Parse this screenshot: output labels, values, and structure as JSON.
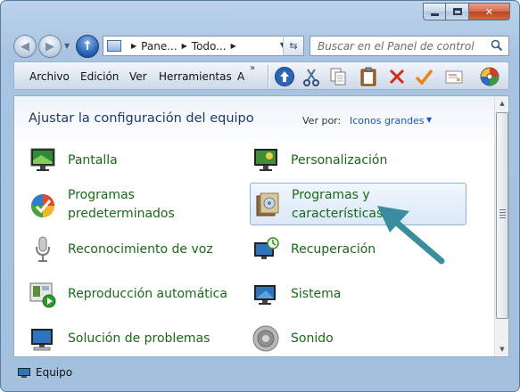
{
  "address": {
    "crumbs": [
      "Pane...",
      "Todo..."
    ]
  },
  "search": {
    "placeholder": "Buscar en el Panel de control"
  },
  "menu": {
    "items": [
      "Archivo",
      "Edición",
      "Ver",
      "Herramientas",
      "A"
    ],
    "overflow": "»"
  },
  "toolbar": {
    "icons": [
      "up-arrow-icon",
      "cut-icon",
      "copy-icon",
      "paste-icon",
      "delete-icon",
      "check-icon",
      "properties-icon",
      "color-wheel-icon"
    ]
  },
  "header": {
    "title": "Ajustar la configuración del equipo",
    "view_label": "Ver por:",
    "view_value": "Iconos grandes"
  },
  "items": [
    {
      "label": "Pantalla",
      "icon": "monitor-icon"
    },
    {
      "label": "Personalización",
      "icon": "personalization-icon"
    },
    {
      "label": "Programas\npredeterminados",
      "icon": "default-programs-icon"
    },
    {
      "label": "Programas y\ncaracterísticas",
      "icon": "programs-features-icon"
    },
    {
      "label": "Reconocimiento de voz",
      "icon": "microphone-icon"
    },
    {
      "label": "Recuperación",
      "icon": "recovery-icon"
    },
    {
      "label": "Reproducción automática",
      "icon": "autoplay-icon"
    },
    {
      "label": "Sistema",
      "icon": "system-icon"
    },
    {
      "label": "Solución de problemas",
      "icon": "troubleshoot-icon"
    },
    {
      "label": "Sonido",
      "icon": "speaker-icon"
    }
  ],
  "status": {
    "text": "Equipo"
  },
  "colors": {
    "accent_arrow": "#3a8d9c",
    "link_green": "#196a18",
    "title_blue": "#1f3a63"
  }
}
